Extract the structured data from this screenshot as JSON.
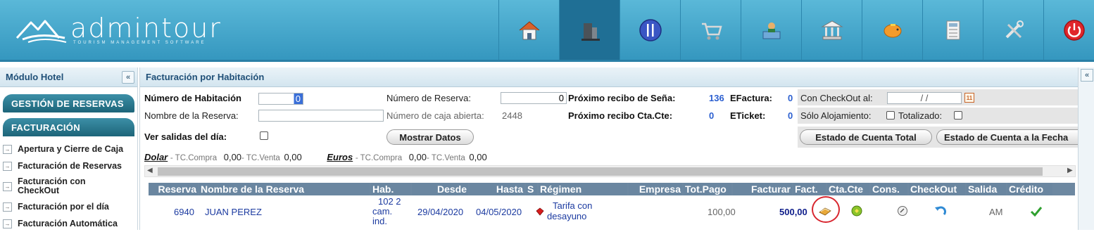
{
  "app": {
    "logo_text": "admintour",
    "logo_tagline": "TOURISM MANAGEMENT SOFTWARE"
  },
  "topnav": [
    {
      "icon": "home-icon"
    },
    {
      "icon": "building-icon",
      "active": true
    },
    {
      "icon": "restaurant-icon"
    },
    {
      "icon": "cart-icon"
    },
    {
      "icon": "reception-icon"
    },
    {
      "icon": "bank-icon"
    },
    {
      "icon": "piggy-bank-icon"
    },
    {
      "icon": "calculator-icon"
    },
    {
      "icon": "tools-icon"
    },
    {
      "icon": "power-icon"
    }
  ],
  "sidebar": {
    "title": "Módulo Hotel",
    "collapse": "«",
    "section1": "GESTIÓN DE RESERVAS",
    "section2": "FACTURACIÓN",
    "items": [
      {
        "label": "Apertura y Cierre de Caja"
      },
      {
        "label": "Facturación de Reservas"
      },
      {
        "label": "Facturación con CheckOut"
      },
      {
        "label": "Facturación por el día"
      },
      {
        "label": "Facturación Automática"
      }
    ]
  },
  "main": {
    "title": "Facturación por Habitación",
    "right_collapse": "«",
    "form": {
      "nro_habitacion_label": "Número de Habitación",
      "nro_habitacion_value": "0",
      "nro_reserva_label": "Número de Reserva:",
      "nro_reserva_value": "0",
      "nombre_reserva_label": "Nombre de la Reserva:",
      "nombre_reserva_value": "",
      "caja_abierta_label": "Número de caja abierta:",
      "caja_abierta_value": "2448",
      "ver_salidas_label": "Ver salidas del día:",
      "mostrar_datos": "Mostrar Datos",
      "prox_sena_label": "Próximo recibo de Seña:",
      "prox_sena_value": "136",
      "prox_ctacte_label": "Próximo recibo Cta.Cte:",
      "prox_ctacte_value": "0",
      "efactura_label": "EFactura:",
      "efactura_value": "0",
      "eticket_label": "ETicket:",
      "eticket_value": "0",
      "checkout_label": "Con CheckOut al:",
      "checkout_value": "/ /",
      "solo_aloj_label": "Sólo Alojamiento:",
      "totalizado_label": "Totalizado:",
      "estado_total_btn": "Estado de Cuenta Total",
      "estado_fecha_btn": "Estado de Cuenta a la Fecha"
    },
    "currency": {
      "dolar_label": "Dolar",
      "dolar_tc_compra_label": "- TC.Compra",
      "dolar_tc_compra": "0,00",
      "dolar_tc_venta_label": "- TC.Venta",
      "dolar_tc_venta": "0,00",
      "euros_label": "Euros",
      "euros_tc_compra_label": "- TC.Compra",
      "euros_tc_compra": "0,00",
      "euros_tc_venta_label": "- TC.Venta",
      "euros_tc_venta": "0,00"
    },
    "table": {
      "columns": [
        "Reserva",
        "Nombre de la Reserva",
        "Hab.",
        "Desde",
        "Hasta",
        "S",
        "Régimen",
        "Empresa",
        "Tot.Pago",
        "Facturar",
        "Fact.",
        "Cta.Cte",
        "Cons.",
        "CheckOut",
        "Salida",
        "Crédito"
      ],
      "rows": [
        {
          "reserva": "6940",
          "nombre": "JUAN PEREZ",
          "hab_line1": "102 2",
          "hab_line2": "cam.",
          "hab_line3": "ind.",
          "desde": "29/04/2020",
          "hasta": "04/05/2020",
          "regimen_line1": "Tarifa con",
          "regimen_line2": "desayuno",
          "empresa": "",
          "tot_pago": "100,00",
          "facturar": "500,00",
          "salida": "AM"
        }
      ]
    }
  },
  "colors": {
    "header": "#3aa0c8",
    "section": "#1d6579",
    "table_header": "#6a86a0",
    "highlight": "#d8262f",
    "link": "#1b3aa0"
  }
}
